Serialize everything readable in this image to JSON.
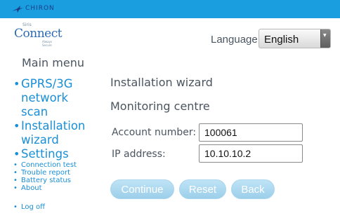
{
  "topbar": {
    "brand": "CHIRON",
    "logo_icon": "chiron-bird-logo-icon"
  },
  "header": {
    "app_logo": {
      "prefix": "Siris",
      "name": "Connect",
      "tagline": "Always Secure"
    },
    "language_label": "Language:",
    "language_value": "English"
  },
  "menu": {
    "title": "Main menu",
    "items": [
      {
        "label": "GPRS/3G network scan",
        "lines": [
          "GPRS/3G",
          "network",
          "scan"
        ]
      },
      {
        "label": "Installation wizard",
        "lines": [
          "Installation",
          "wizard"
        ]
      },
      {
        "label": "Settings"
      },
      {
        "label": "Connection test"
      },
      {
        "label": "Trouble report"
      },
      {
        "label": "Battery status"
      },
      {
        "label": "About"
      },
      {
        "label": "Log off"
      }
    ]
  },
  "main": {
    "title": "Installation wizard",
    "section": "Monitoring centre",
    "fields": [
      {
        "label": "Account number:",
        "value": "100061"
      },
      {
        "label": "IP address:",
        "value": "10.10.10.2"
      }
    ],
    "buttons": {
      "continue": "Continue",
      "reset": "Reset",
      "back": "Back"
    }
  },
  "colors": {
    "topbar": "#1a9ee0",
    "link": "#1a8fd6",
    "text": "#4a5560",
    "button": "#a9d5ee"
  }
}
